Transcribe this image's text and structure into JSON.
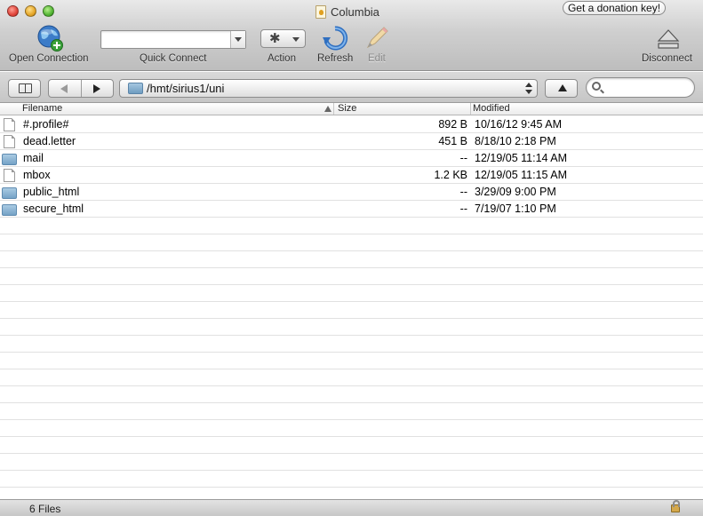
{
  "window": {
    "title": "Columbia"
  },
  "donation": {
    "label": "Get a donation key!"
  },
  "toolbar": {
    "open_connection_label": "Open Connection",
    "quick_connect_label": "Quick Connect",
    "quick_connect_value": "",
    "action_label": "Action",
    "refresh_label": "Refresh",
    "edit_label": "Edit",
    "disconnect_label": "Disconnect"
  },
  "navigation": {
    "path": "/hmt/sirius1/uni",
    "search_placeholder": ""
  },
  "columns": {
    "filename": "Filename",
    "size": "Size",
    "modified": "Modified"
  },
  "files": [
    {
      "name": "#.profile#",
      "size": "892 B",
      "modified": "10/16/12 9:45 AM",
      "kind": "file"
    },
    {
      "name": "dead.letter",
      "size": "451 B",
      "modified": "8/18/10 2:18 PM",
      "kind": "file"
    },
    {
      "name": "mail",
      "size": "--",
      "modified": "12/19/05 11:14 AM",
      "kind": "folder"
    },
    {
      "name": "mbox",
      "size": "1.2 KB",
      "modified": "12/19/05 11:15 AM",
      "kind": "file"
    },
    {
      "name": "public_html",
      "size": "--",
      "modified": "3/29/09 9:00 PM",
      "kind": "folder"
    },
    {
      "name": "secure_html",
      "size": "--",
      "modified": "7/19/07 1:10 PM",
      "kind": "folder"
    }
  ],
  "status": {
    "text": "6 Files"
  },
  "colors": {
    "folder": "#75a2c6",
    "edit_disabled": "#8c8c8c"
  }
}
